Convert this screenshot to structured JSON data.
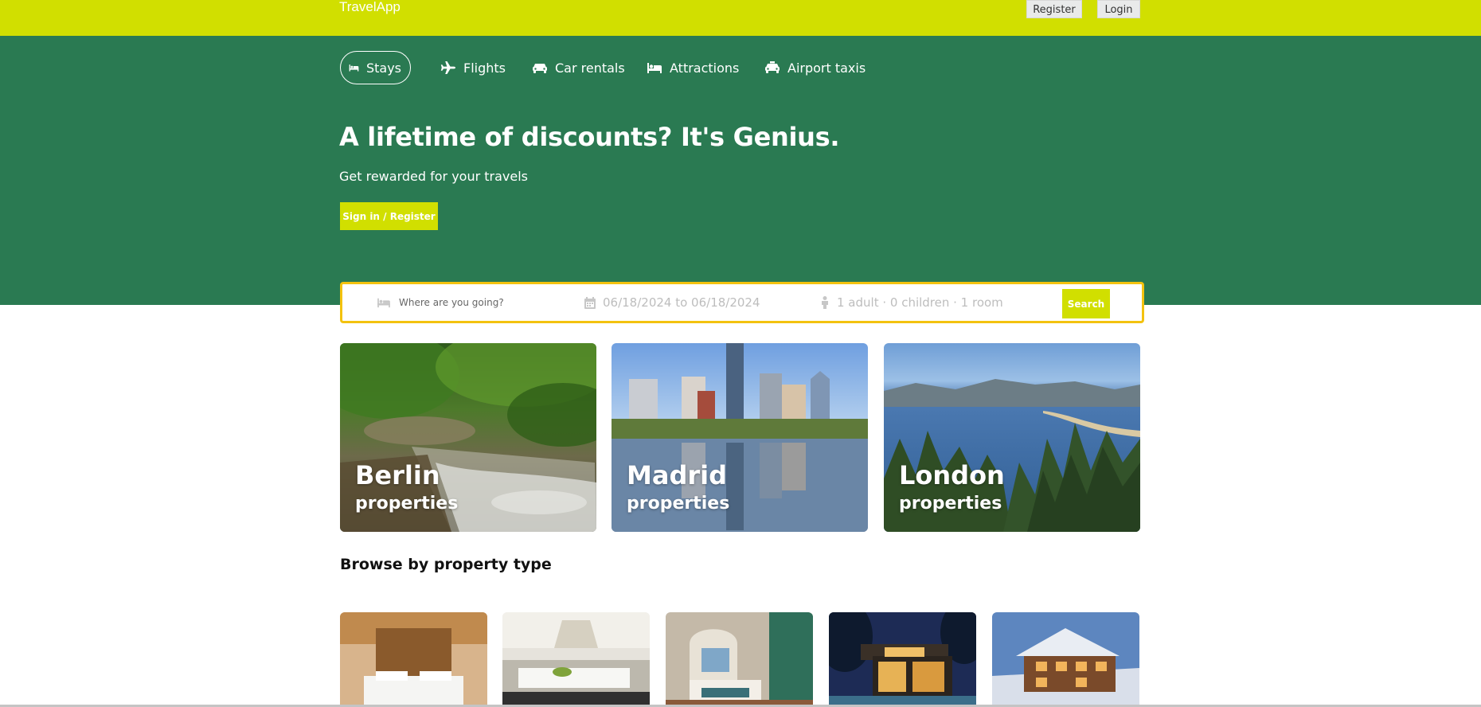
{
  "app": {
    "name": "TravelApp"
  },
  "header": {
    "register_label": "Register",
    "login_label": "Login"
  },
  "nav": {
    "tabs": [
      {
        "label": "Stays",
        "icon": "bed-icon",
        "active": true
      },
      {
        "label": "Flights",
        "icon": "plane-icon",
        "active": false
      },
      {
        "label": "Car rentals",
        "icon": "car-icon",
        "active": false
      },
      {
        "label": "Attractions",
        "icon": "bed-icon",
        "active": false
      },
      {
        "label": "Airport taxis",
        "icon": "taxi-icon",
        "active": false
      }
    ]
  },
  "hero": {
    "title": "A lifetime of discounts? It's Genius.",
    "subtitle": "Get rewarded for your travels",
    "cta_label": "Sign in / Register"
  },
  "search": {
    "destination_placeholder": "Where are you going?",
    "dates": "06/18/2024 to 06/18/2024",
    "guests": "1 adult · 0 children · 1 room",
    "button_label": "Search"
  },
  "featured": [
    {
      "city": "Berlin",
      "subtitle": "properties"
    },
    {
      "city": "Madrid",
      "subtitle": "properties"
    },
    {
      "city": "London",
      "subtitle": "properties"
    }
  ],
  "browse": {
    "title": "Browse by property type"
  },
  "colors": {
    "brand_lime": "#d1df00",
    "hero_green": "#2a7a52",
    "search_border": "#f3c20f"
  }
}
